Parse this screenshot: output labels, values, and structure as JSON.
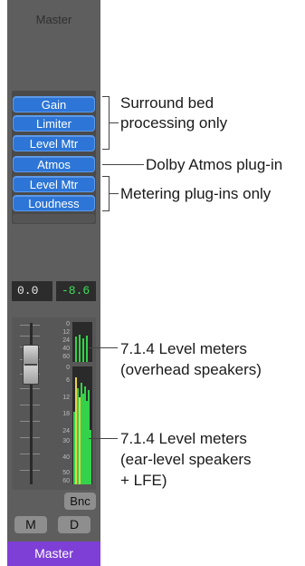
{
  "strip": {
    "name_top": "Master",
    "name_bottom": "Master",
    "plugins": [
      {
        "label": "Gain"
      },
      {
        "label": "Limiter"
      },
      {
        "label": "Level Mtr"
      },
      {
        "label": "Atmos"
      },
      {
        "label": "Level Mtr"
      },
      {
        "label": "Loudness"
      }
    ],
    "volume": "0.0",
    "peak": "-8.6",
    "scale_top": [
      "0",
      "12",
      "24",
      "40",
      "60"
    ],
    "scale_bottom": [
      "0",
      "6",
      "12",
      "18",
      "24",
      "30",
      "40",
      "50",
      "60"
    ],
    "bounce_label": "Bnc",
    "mute_label": "M",
    "dim_label": "D",
    "colors": {
      "plugin_blue": "#2d75d6",
      "name_purple": "#7e3fd6",
      "meter_green": "#33d24a",
      "peak_green": "#3fe05a"
    }
  },
  "annotations": {
    "surround_line1": "Surround bed",
    "surround_line2": "processing only",
    "atmos": "Dolby Atmos plug-in",
    "metering": "Metering plug-ins only",
    "overhead_line1": "7.1.4 Level meters",
    "overhead_line2": "(overhead speakers)",
    "ear_line1": "7.1.4 Level meters",
    "ear_line2": "(ear-level speakers",
    "ear_line3": "+ LFE)"
  }
}
